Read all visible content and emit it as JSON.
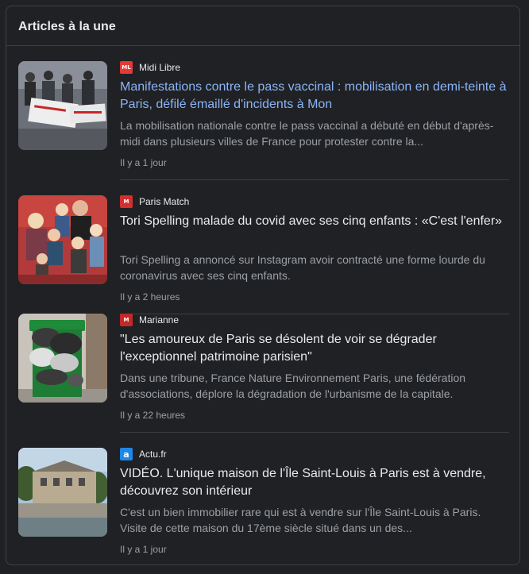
{
  "card": {
    "title": "Articles à la une"
  },
  "articles": [
    {
      "source": "Midi Libre",
      "favicon_text": "ML",
      "favicon_color": "#e53935",
      "headline": "Manifestations contre le pass vaccinal : mobilisation en demi-teinte à Paris, défilé émaillé d'incidents à Mon",
      "snippet": "La mobilisation nationale contre le pass vaccinal a débuté en début d'après-midi dans plusieurs villes de France pour protester contre la...",
      "time": "Il y a 1 jour",
      "thumb_icon": "protest-photo"
    },
    {
      "source": "Paris Match",
      "favicon_text": "M",
      "favicon_color": "#d32f2f",
      "headline": "Tori Spelling malade du covid avec ses cinq enfants : «C'est l'enfer»",
      "snippet": "Tori Spelling a annoncé sur Instagram avoir contracté une forme lourde du coronavirus avec ses cinq enfants.",
      "time": "Il y a 2 heures",
      "thumb_icon": "family-photo"
    },
    {
      "source": "Marianne",
      "favicon_text": "M",
      "favicon_color": "#c62828",
      "headline": "\"Les amoureux de Paris se désolent de voir se dégrader l'exceptionnel patrimoine parisien\"",
      "snippet": "Dans une tribune, France Nature Environnement Paris, une fédération d'associations, déplore la dégradation de l'urbanisme de la capitale.",
      "time": "Il y a 22 heures",
      "thumb_icon": "trash-bin-photo"
    },
    {
      "source": "Actu.fr",
      "favicon_text": "a",
      "favicon_color": "#1e88e5",
      "headline": "VIDÉO. L'unique maison de l'Île Saint-Louis à Paris est à vendre, découvrez son intérieur",
      "snippet": "C'est un bien immobilier rare qui est à vendre sur l'Île Saint-Louis à Paris. Visite de cette maison du 17ème siècle situé dans un des...",
      "time": "Il y a 1 jour",
      "thumb_icon": "house-photo"
    }
  ]
}
